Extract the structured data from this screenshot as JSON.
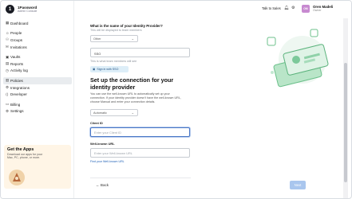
{
  "app": {
    "brand_title": "1Password",
    "brand_sub": "Admin Console",
    "brand_logo_glyph": "1"
  },
  "sidebar": {
    "items": [
      {
        "label": "Dashboard",
        "icon": "dashboard-icon",
        "glyph": "▦"
      },
      {
        "label": "People",
        "icon": "person-icon",
        "glyph": "☺"
      },
      {
        "label": "Groups",
        "icon": "groups-icon",
        "glyph": "⚇"
      },
      {
        "label": "Invitations",
        "icon": "envelope-icon",
        "glyph": "✉"
      },
      {
        "label": "Vaults",
        "icon": "vault-icon",
        "glyph": "▣"
      },
      {
        "label": "Reports",
        "icon": "reports-icon",
        "glyph": "▤"
      },
      {
        "label": "Activity log",
        "icon": "clock-icon",
        "glyph": "◷"
      },
      {
        "label": "Policies",
        "icon": "policies-icon",
        "glyph": "▥"
      },
      {
        "label": "Integrations",
        "icon": "integrations-icon",
        "glyph": "⚙"
      },
      {
        "label": "Developer",
        "icon": "code-icon",
        "glyph": "⟨⟩"
      },
      {
        "label": "Billing",
        "icon": "billing-icon",
        "glyph": "▭"
      },
      {
        "label": "Settings",
        "icon": "gear-icon",
        "glyph": "⚙"
      }
    ],
    "active_index": 7,
    "promo": {
      "title": "Get the Apps",
      "text": "Download our apps for your Mac, PC, phone, or more."
    }
  },
  "topbar": {
    "talk_to_sales": "Talk to Sales",
    "avatar_initials": "OM",
    "user_name": "Oren Madeli",
    "user_role": "Owner",
    "colors": {
      "avatar": "#c78ad0"
    }
  },
  "form": {
    "question": "What is the name of your Identity Provider?",
    "question_hint": "This will be displayed to team members",
    "provider_select": "Other",
    "provider_name_value": "SSO",
    "provider_name_hint": "This is what team members will see",
    "sso_button": "Sign in with SSO",
    "section_title": "Set up the connection for your identity provider",
    "section_text": "You can use the well-known URL to automatically set up your connection. If your identity provider doesn't have the well-known URL, choose Manual and enter your connection details.",
    "mode_select": "Automatic",
    "client_id_label": "Client ID",
    "client_id_placeholder": "Enter your Client ID",
    "wellknown_label": "Well-known URL",
    "wellknown_placeholder": "Enter your Well-known URL",
    "find_link": "Find your Well-known URL",
    "back_label": "Back",
    "next_label": "Next"
  },
  "colors": {
    "accent": "#1d5fb5",
    "next_button": "#a9c6ee",
    "active_nav": "#e9ecef",
    "promo_bg": "#fff5e6"
  }
}
